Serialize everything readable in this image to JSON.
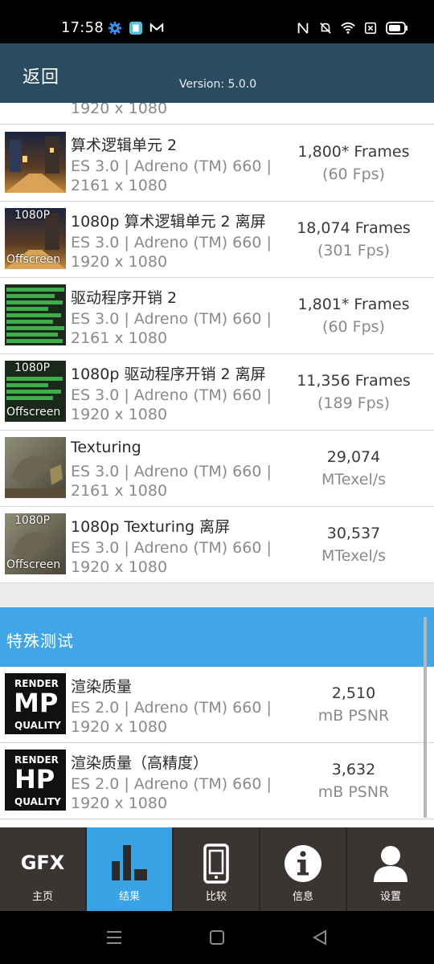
{
  "status": {
    "time": "17:58"
  },
  "header": {
    "back_label": "返回",
    "version": "Version: 5.0.0"
  },
  "results": {
    "partial_row": {
      "sub": "1920 x 1080"
    },
    "rows": [
      {
        "title": "算术逻辑单元 2",
        "api": "ES 3.0 | Adreno (TM) 660 |",
        "resolution": "2161 x 1080",
        "value": "1,800* Frames",
        "unit": "(60 Fps)",
        "thumb": "alu",
        "badge_top": "",
        "badge_bottom": ""
      },
      {
        "title": "1080p 算术逻辑单元 2 离屏",
        "api": "ES 3.0 | Adreno (TM) 660 |",
        "resolution": "1920 x 1080",
        "value": "18,074 Frames",
        "unit": "(301 Fps)",
        "thumb": "alu",
        "badge_top": "1080P",
        "badge_bottom": "Offscreen"
      },
      {
        "title": "驱动程序开销 2",
        "api": "ES 3.0 | Adreno (TM) 660 |",
        "resolution": "2161 x 1080",
        "value": "1,801* Frames",
        "unit": "(60 Fps)",
        "thumb": "driver",
        "badge_top": "",
        "badge_bottom": ""
      },
      {
        "title": "1080p 驱动程序开销 2 离屏",
        "api": "ES 3.0 | Adreno (TM) 660 |",
        "resolution": "1920 x 1080",
        "value": "11,356 Frames",
        "unit": "(189 Fps)",
        "thumb": "driver",
        "badge_top": "1080P",
        "badge_bottom": "Offscreen"
      },
      {
        "title": "Texturing",
        "api": "ES 3.0 | Adreno (TM) 660 |",
        "resolution": "2161 x 1080",
        "value": "29,074",
        "unit": "MTexel/s",
        "thumb": "texture",
        "badge_top": "",
        "badge_bottom": ""
      },
      {
        "title": "1080p Texturing 离屏",
        "api": "ES 3.0 | Adreno (TM) 660 |",
        "resolution": "1920 x 1080",
        "value": "30,537",
        "unit": "MTexel/s",
        "thumb": "texture",
        "badge_top": "1080P",
        "badge_bottom": "Offscreen"
      }
    ]
  },
  "special": {
    "section_title": "特殊测试",
    "rows": [
      {
        "title": "渲染质量",
        "api": "ES 2.0 | Adreno (TM) 660 |",
        "resolution": "1920 x 1080",
        "value": "2,510",
        "unit": "mB PSNR",
        "badge_top": "RENDER",
        "badge_mid": "MP",
        "badge_bottom": "QUALITY"
      },
      {
        "title": "渲染质量（高精度）",
        "api": "ES 2.0 | Adreno (TM) 660 |",
        "resolution": "1920 x 1080",
        "value": "3,632",
        "unit": "mB PSNR",
        "badge_top": "RENDER",
        "badge_mid": "HP",
        "badge_bottom": "QUALITY"
      }
    ]
  },
  "tabs": [
    {
      "label": "主页",
      "icon": "gfx-logo-icon",
      "logo_text": "GFX",
      "active": false
    },
    {
      "label": "结果",
      "icon": "bar-chart-icon",
      "active": true
    },
    {
      "label": "比较",
      "icon": "phone-icon",
      "active": false
    },
    {
      "label": "信息",
      "icon": "info-icon",
      "logo_text": "i",
      "active": false
    },
    {
      "label": "设置",
      "icon": "user-icon",
      "active": false
    }
  ],
  "colors": {
    "header_bg": "#2b4b61",
    "section_bg": "#41a6e8",
    "tab_active": "#3aa3e6",
    "tab_bg": "#3a3533"
  }
}
